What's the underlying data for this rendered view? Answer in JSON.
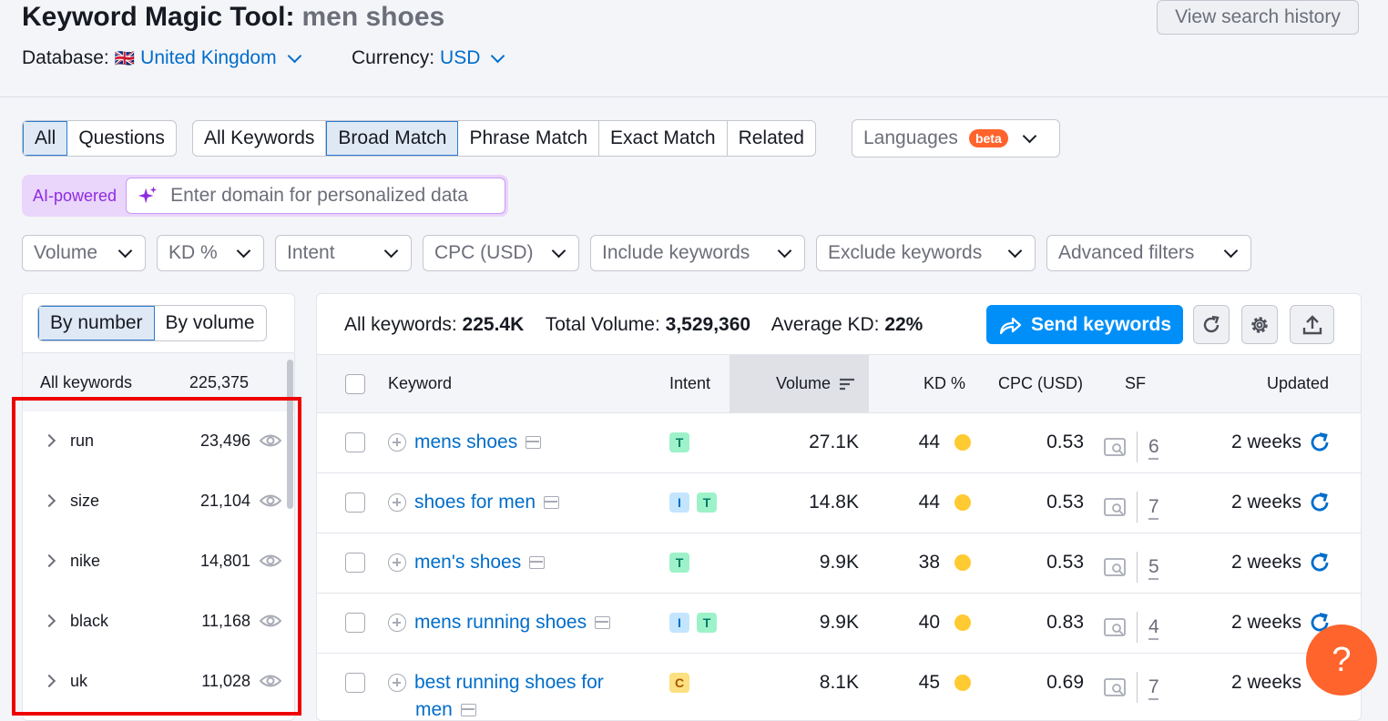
{
  "header": {
    "title": "Keyword Magic Tool:",
    "query": "men shoes",
    "history_button": "View search history",
    "database_label": "Database:",
    "database_flag": "🇬🇧",
    "database_value": "United Kingdom",
    "currency_label": "Currency:",
    "currency_value": "USD"
  },
  "question_tabs": [
    "All",
    "Questions"
  ],
  "match_tabs": [
    "All Keywords",
    "Broad Match",
    "Phrase Match",
    "Exact Match",
    "Related"
  ],
  "languages": {
    "label": "Languages",
    "badge": "beta"
  },
  "ai": {
    "label": "AI-powered",
    "placeholder": "Enter domain for personalized data"
  },
  "filters": [
    "Volume",
    "KD %",
    "Intent",
    "CPC (USD)",
    "Include keywords",
    "Exclude keywords",
    "Advanced filters"
  ],
  "groups": {
    "toggle": [
      "By number",
      "By volume"
    ],
    "all_label": "All keywords",
    "all_count": "225,375",
    "items": [
      {
        "name": "run",
        "count": "23,496"
      },
      {
        "name": "size",
        "count": "21,104"
      },
      {
        "name": "nike",
        "count": "14,801"
      },
      {
        "name": "black",
        "count": "11,168"
      },
      {
        "name": "uk",
        "count": "11,028"
      }
    ]
  },
  "summary": {
    "all_keywords_label": "All keywords:",
    "all_keywords_value": "225.4K",
    "total_volume_label": "Total Volume:",
    "total_volume_value": "3,529,360",
    "avg_kd_label": "Average KD:",
    "avg_kd_value": "22%",
    "send_button": "Send keywords"
  },
  "table": {
    "columns": [
      "Keyword",
      "Intent",
      "Volume",
      "KD %",
      "CPC (USD)",
      "SF",
      "Updated"
    ],
    "rows": [
      {
        "keyword": "mens shoes",
        "intent": [
          "T"
        ],
        "volume": "27.1K",
        "kd": "44",
        "cpc": "0.53",
        "sf": "6",
        "updated": "2 weeks"
      },
      {
        "keyword": "shoes for men",
        "intent": [
          "I",
          "T"
        ],
        "volume": "14.8K",
        "kd": "44",
        "cpc": "0.53",
        "sf": "7",
        "updated": "2 weeks"
      },
      {
        "keyword": "men's shoes",
        "intent": [
          "T"
        ],
        "volume": "9.9K",
        "kd": "38",
        "cpc": "0.53",
        "sf": "5",
        "updated": "2 weeks"
      },
      {
        "keyword": "mens running shoes",
        "intent": [
          "I",
          "T"
        ],
        "volume": "9.9K",
        "kd": "40",
        "cpc": "0.83",
        "sf": "4",
        "updated": "2 weeks"
      },
      {
        "keyword": "best running shoes for",
        "keyword_line2": "men",
        "intent": [
          "C"
        ],
        "volume": "8.1K",
        "kd": "45",
        "cpc": "0.69",
        "sf": "7",
        "updated": "2 weeks"
      }
    ]
  },
  "help_button": "?",
  "colors": {
    "accent": "#006dca",
    "send": "#008ff8",
    "help": "#ff642d",
    "highlight_box": "#e00000",
    "kd_dot": "#ffca32"
  }
}
